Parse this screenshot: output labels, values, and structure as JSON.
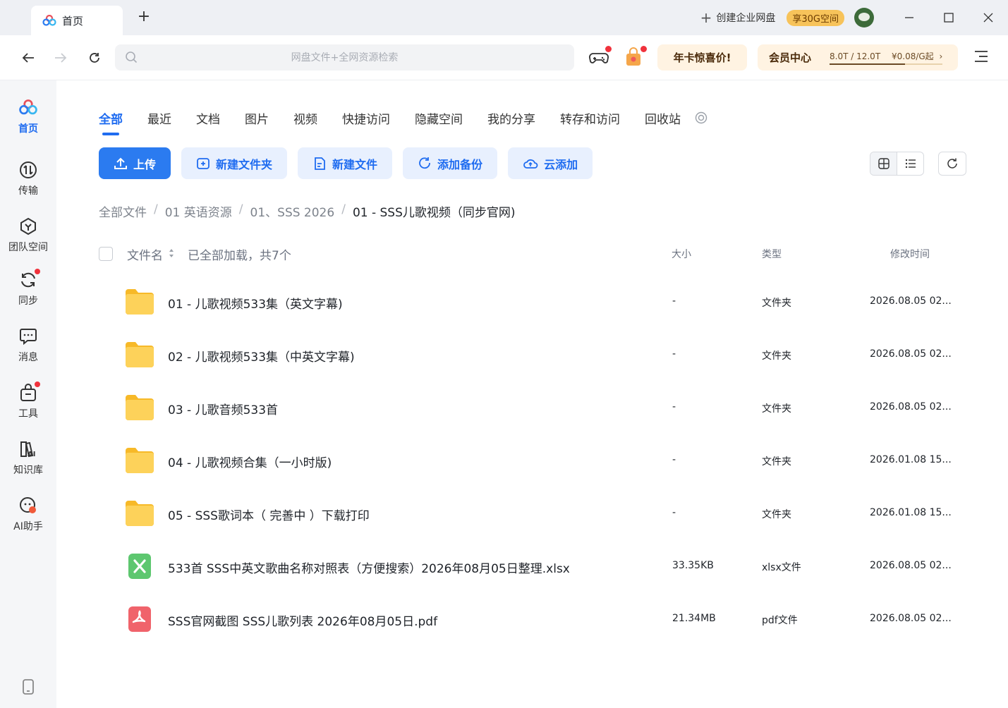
{
  "titlebar": {
    "tab_label": "首页",
    "create_enterprise": "创建企业网盘",
    "promo_badge": "享30G空间"
  },
  "navbar": {
    "search_placeholder": "网盘文件+全网资源检索",
    "annual_promo": "年卡惊喜价!",
    "vip_center": "会员中心",
    "vip_storage": "8.0T / 12.0T",
    "vip_price": "¥0.08/G起",
    "storage_used_fraction": 0.667
  },
  "sidebar": {
    "items": [
      {
        "label": "首页"
      },
      {
        "label": "传输"
      },
      {
        "label": "团队空间"
      },
      {
        "label": "同步"
      },
      {
        "label": "消息"
      },
      {
        "label": "工具"
      },
      {
        "label": "知识库"
      },
      {
        "label": "AI助手"
      }
    ]
  },
  "category_tabs": [
    "全部",
    "最近",
    "文档",
    "图片",
    "视频",
    "快捷访问",
    "隐藏空间",
    "我的分享",
    "转存和访问",
    "回收站"
  ],
  "actions": {
    "upload": "上传",
    "new_folder": "新建文件夹",
    "new_file": "新建文件",
    "add_backup": "添加备份",
    "cloud_add": "云添加"
  },
  "breadcrumb": [
    "全部文件",
    "01 英语资源",
    "01、SSS 2026",
    "01 - SSS儿歌视频（同步官网)"
  ],
  "list_header": {
    "name": "文件名",
    "loaded_status": "已全部加载，共7个",
    "size": "大小",
    "type": "类型",
    "modified": "修改时间"
  },
  "files": [
    {
      "name": "01 - 儿歌视频533集（英文字幕)",
      "size": "-",
      "type": "文件夹",
      "modified": "2026.08.05 02...",
      "icon": "folder"
    },
    {
      "name": "02 - 儿歌视频533集（中英文字幕)",
      "size": "-",
      "type": "文件夹",
      "modified": "2026.08.05 02...",
      "icon": "folder"
    },
    {
      "name": "03 - 儿歌音频533首",
      "size": "-",
      "type": "文件夹",
      "modified": "2026.08.05 02...",
      "icon": "folder"
    },
    {
      "name": "04 - 儿歌视频合集（一小时版)",
      "size": "-",
      "type": "文件夹",
      "modified": "2026.01.08 15...",
      "icon": "folder"
    },
    {
      "name": "05 - SSS歌词本（ 完善中 ）下载打印",
      "size": "-",
      "type": "文件夹",
      "modified": "2026.01.08 15...",
      "icon": "folder"
    },
    {
      "name": "533首 SSS中英文歌曲名称对照表（方便搜索）2026年08月05日整理.xlsx",
      "size": "33.35KB",
      "type": "xlsx文件",
      "modified": "2026.08.05 02...",
      "icon": "xlsx"
    },
    {
      "name": "SSS官网截图 SSS儿歌列表 2026年08月05日.pdf",
      "size": "21.34MB",
      "type": "pdf文件",
      "modified": "2026.08.05 02...",
      "icon": "pdf"
    }
  ],
  "colors": {
    "accent": "#1f6cf0",
    "primary_button": "#2b7bf0",
    "folder": "#fcc93f",
    "xlsx": "#5dc76f",
    "pdf": "#f0636b",
    "notification_dot": "#f0323c"
  }
}
